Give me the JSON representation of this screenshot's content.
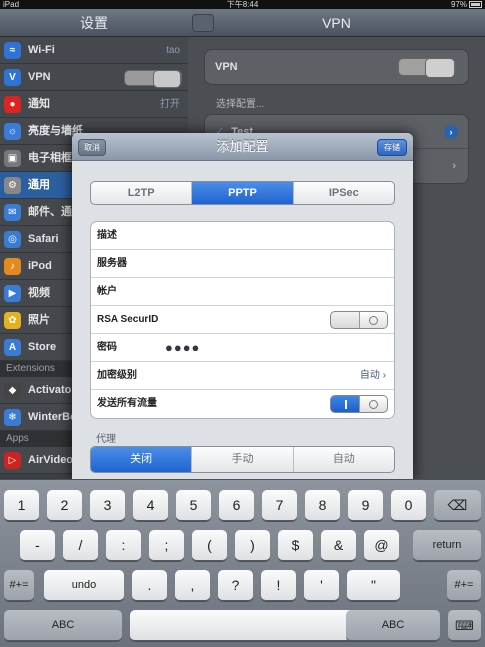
{
  "statusbar": {
    "device": "iPad",
    "time": "下午8:44",
    "battery": "97%"
  },
  "sidebar": {
    "title": "设置",
    "items": [
      {
        "label": "Wi-Fi",
        "value": "tao",
        "icon": "wifi-icon",
        "color": "#2f73d8"
      },
      {
        "label": "VPN",
        "value": "",
        "icon": "vpn-icon",
        "color": "#2f73d8",
        "toggle": true
      },
      {
        "label": "通知",
        "value": "打开",
        "icon": "notification-icon",
        "color": "#d22"
      },
      {
        "label": "亮度与墙纸",
        "value": "",
        "icon": "brightness-icon",
        "color": "#3a7bd5"
      },
      {
        "label": "电子相框",
        "value": "",
        "icon": "photo-frame-icon",
        "color": "#777"
      },
      {
        "label": "通用",
        "value": "",
        "icon": "gear-icon",
        "color": "#888",
        "selected": true
      },
      {
        "label": "邮件、通讯录、日历",
        "value": "",
        "icon": "mail-icon",
        "color": "#3a7bd5"
      },
      {
        "label": "Safari",
        "value": "",
        "icon": "safari-icon",
        "color": "#3a7bd5"
      },
      {
        "label": "iPod",
        "value": "",
        "icon": "ipod-icon",
        "color": "#e28a1e"
      },
      {
        "label": "视频",
        "value": "",
        "icon": "video-icon",
        "color": "#3a7bd5"
      },
      {
        "label": "照片",
        "value": "",
        "icon": "photos-icon",
        "color": "#e6b020"
      },
      {
        "label": "Store",
        "value": "",
        "icon": "store-icon",
        "color": "#3a7bd5"
      }
    ],
    "section_extensions": "Extensions",
    "ext_items": [
      {
        "label": "Activator",
        "icon": "activator-icon",
        "color": "#444"
      },
      {
        "label": "WinterBoard",
        "icon": "winterboard-icon",
        "color": "#3a7bd5"
      }
    ],
    "section_apps": "Apps",
    "app_items": [
      {
        "label": "AirVideo",
        "icon": "airvideo-icon",
        "color": "#c22"
      }
    ]
  },
  "detail": {
    "title": "VPN",
    "vpn_label": "VPN",
    "choose_label": "选择配置...",
    "config_name": "Test"
  },
  "modal": {
    "title": "添加配置",
    "cancel": "取消",
    "save": "存储",
    "types": [
      "L2TP",
      "PPTP",
      "IPSec"
    ],
    "selected_type": 1,
    "fields": {
      "description": "描述",
      "server": "服务器",
      "account": "帐户",
      "rsa": "RSA SecurID",
      "password": "密码",
      "password_value": "●●●●",
      "encryption": "加密级别",
      "encryption_value": "自动",
      "send_all": "发送所有流量"
    },
    "proxy_label": "代理",
    "proxy_options": [
      "关闭",
      "手动",
      "自动"
    ],
    "proxy_selected": 0
  },
  "keyboard": {
    "row1": [
      "1",
      "2",
      "3",
      "4",
      "5",
      "6",
      "7",
      "8",
      "9",
      "0"
    ],
    "row2": [
      "-",
      "/",
      ":",
      ";",
      "(",
      ")",
      "$",
      "&",
      "@"
    ],
    "return": "return",
    "row3_left": "#+=",
    "undo": "undo",
    "row3": [
      ".",
      ",",
      "?",
      "!",
      "'",
      "\""
    ],
    "row3_right": "#+=",
    "abc": "ABC"
  }
}
